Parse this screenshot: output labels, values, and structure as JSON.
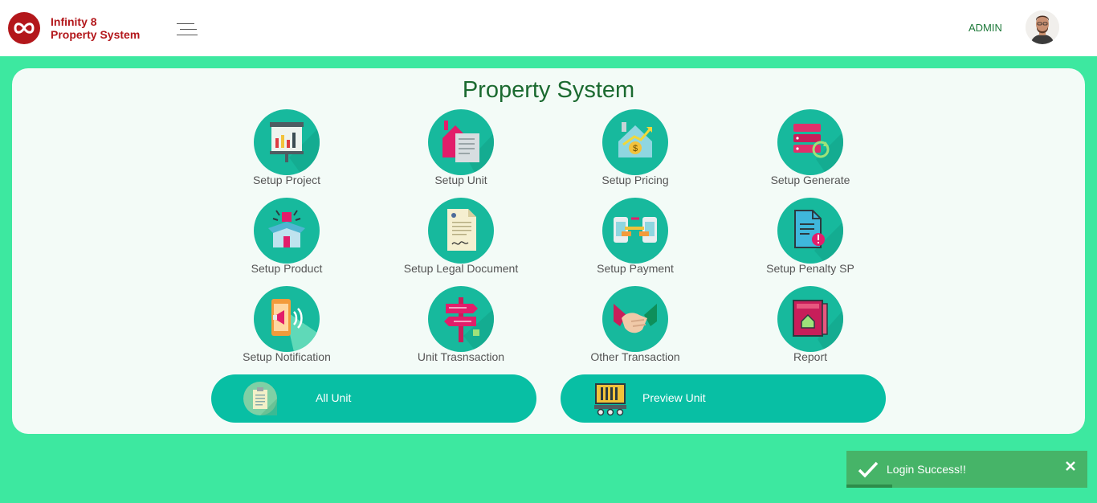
{
  "header": {
    "brand_line1": "Infinity 8",
    "brand_line2": "Property System",
    "user_label": "ADMIN"
  },
  "main": {
    "title": "Property System",
    "tiles": [
      {
        "label": "Setup Project",
        "icon": "presentation-board-icon"
      },
      {
        "label": "Setup Unit",
        "icon": "house-document-icon"
      },
      {
        "label": "Setup Pricing",
        "icon": "house-price-growth-icon"
      },
      {
        "label": "Setup Generate",
        "icon": "server-refresh-icon"
      },
      {
        "label": "Setup Product",
        "icon": "product-box-icon"
      },
      {
        "label": "Setup Legal Document",
        "icon": "signed-document-icon"
      },
      {
        "label": "Setup Payment",
        "icon": "phone-payment-transfer-icon"
      },
      {
        "label": "Setup Penalty SP",
        "icon": "document-warning-icon"
      },
      {
        "label": "Setup Notification",
        "icon": "phone-megaphone-icon"
      },
      {
        "label": "Unit Trasnsaction",
        "icon": "signpost-icon"
      },
      {
        "label": "Other Transaction",
        "icon": "handshake-icon"
      },
      {
        "label": "Report",
        "icon": "report-book-icon"
      }
    ],
    "all_unit_label": "All Unit",
    "preview_unit_label": "Preview Unit"
  },
  "toast": {
    "message": "Login Success!!",
    "progress": 0.19
  },
  "colors": {
    "page_bg": "#3de8a0",
    "brand": "#b3171b",
    "tile_circle": "#17b99d",
    "button": "#08bfa4",
    "toast": "#46b468"
  }
}
